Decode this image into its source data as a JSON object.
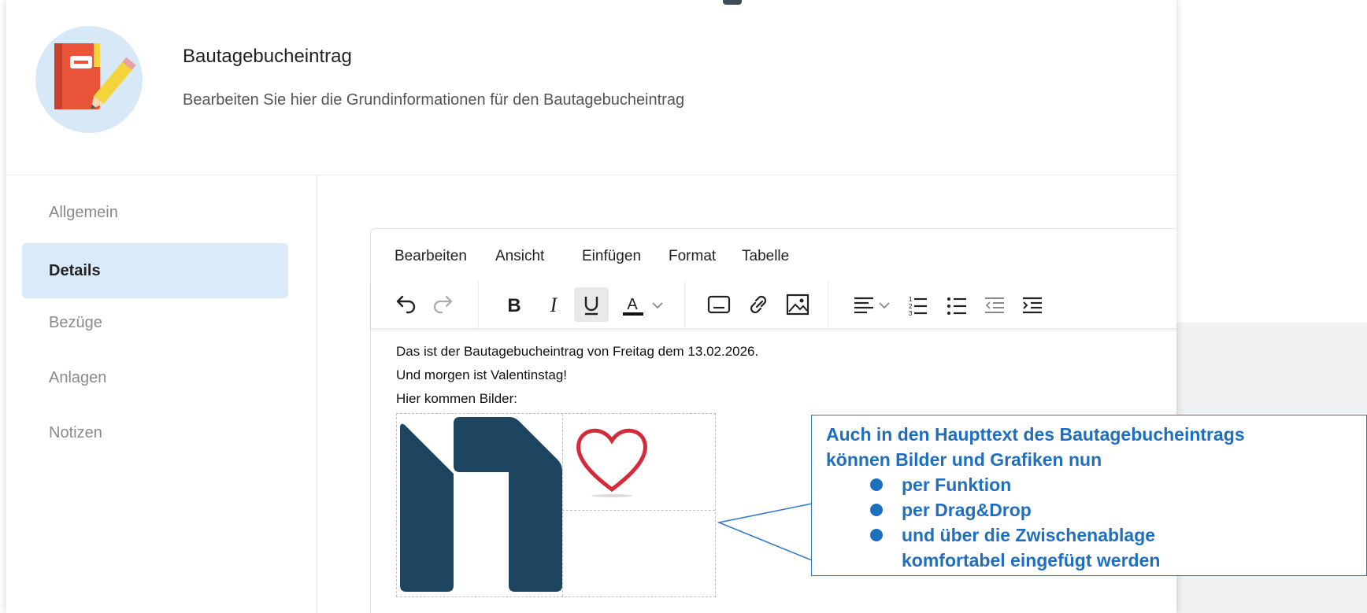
{
  "header": {
    "title": "Bautagebucheintrag",
    "subtitle": "Bearbeiten Sie hier die Grundinformationen für den Bautagebucheintrag"
  },
  "sidebar": {
    "items": [
      {
        "label": "Allgemein",
        "active": false
      },
      {
        "label": "Details",
        "active": true
      },
      {
        "label": "Bezüge",
        "active": false
      },
      {
        "label": "Anlagen",
        "active": false
      },
      {
        "label": "Notizen",
        "active": false
      }
    ]
  },
  "editor": {
    "menu": [
      "Bearbeiten",
      "Ansicht",
      "Einfügen",
      "Format",
      "Tabelle"
    ],
    "toolbar_icons": [
      "undo-icon",
      "redo-icon",
      "bold-icon",
      "italic-icon",
      "underline-icon",
      "text-color-icon",
      "chevron-down-icon",
      "embed-icon",
      "link-icon",
      "image-icon",
      "align-left-icon",
      "chevron-down-icon",
      "numbered-list-icon",
      "bullet-list-icon",
      "outdent-icon",
      "indent-icon"
    ],
    "content": {
      "line1": "Das ist der Bautagebucheintrag von Freitag dem 13.02.2026.",
      "line2": "Und morgen ist Valentinstag!",
      "line3": "Hier kommen Bilder:"
    }
  },
  "callout": {
    "line1": "Auch in den Haupttext des Bautagebucheintrags",
    "line2": "können Bilder und Grafiken nun",
    "bullets": [
      "per Funktion",
      "per Drag&Drop",
      "und über die Zwischenablage"
    ],
    "continuation": "komfortabel eingefügt werden"
  },
  "colors": {
    "accent": "#1f6fc1",
    "active_nav": "#dbeaf8",
    "logo": "#1e4560",
    "heart": "#d42b3a",
    "book": "#e8533a"
  }
}
